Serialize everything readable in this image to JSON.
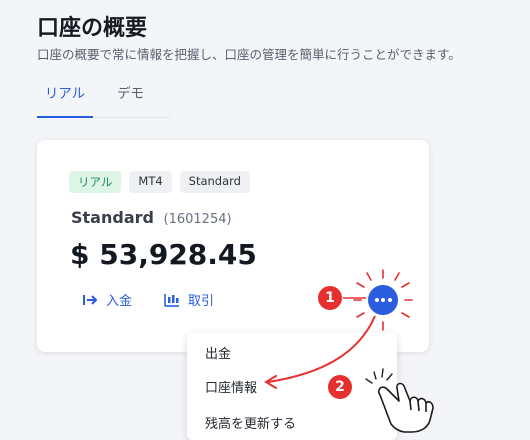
{
  "header": {
    "title": "口座の概要",
    "subtitle": "口座の概要で常に情報を把握し、口座の管理を簡単に行うことができます。"
  },
  "tabs": [
    {
      "label": "リアル",
      "active": true
    },
    {
      "label": "デモ",
      "active": false
    }
  ],
  "account": {
    "badges": [
      "リアル",
      "MT4",
      "Standard"
    ],
    "name": "Standard",
    "number": "(1601254)",
    "balance": "$ 53,928.45",
    "actions": {
      "deposit_label": "入金",
      "trade_label": "取引"
    }
  },
  "menu": {
    "items": [
      "出金",
      "口座情報",
      "残高を更新する"
    ]
  },
  "annotations": {
    "step1": "1",
    "step2": "2"
  },
  "colors": {
    "accent": "#2a5de0",
    "annotation": "#e63030",
    "badge_real_bg": "#dcf5e6",
    "badge_real_text": "#1f8a4a"
  },
  "icons": [
    "enter-arrow-icon",
    "candlestick-chart-icon",
    "more-dots-icon",
    "pointing-hand-icon"
  ]
}
